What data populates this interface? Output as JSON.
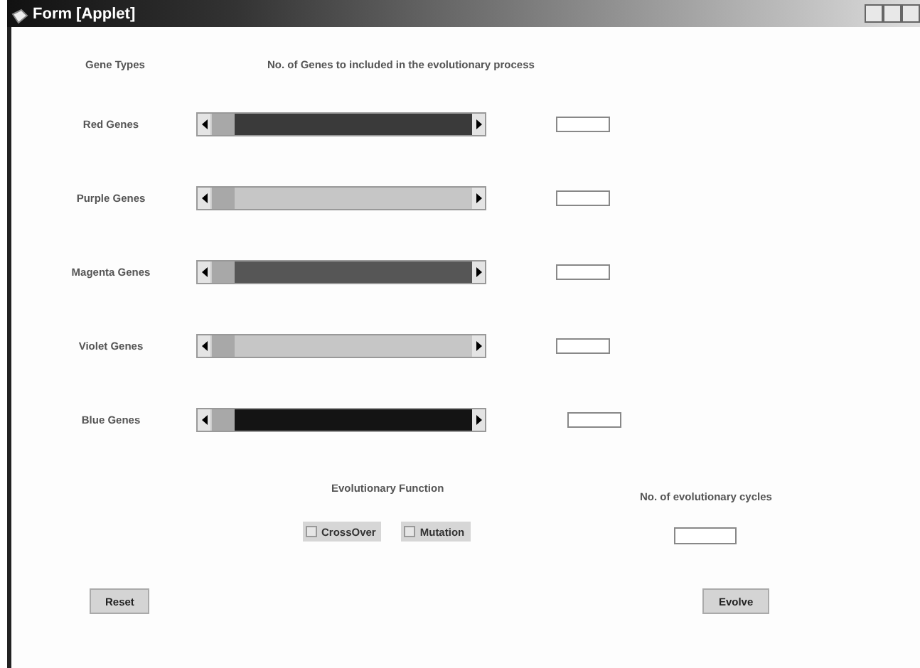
{
  "window": {
    "title": "Form [Applet]"
  },
  "headers": {
    "gene_types": "Gene Types",
    "genes_count": "No. of Genes to included in the evolutionary process"
  },
  "genes": [
    {
      "label": "Red Genes",
      "level": 0,
      "color": "#3a3a3a"
    },
    {
      "label": "Purple Genes",
      "level": 0,
      "color": "#c6c6c6"
    },
    {
      "label": "Magenta Genes",
      "level": 0,
      "color": "#565656"
    },
    {
      "label": "Violet Genes",
      "level": 0,
      "color": "#c6c6c6"
    },
    {
      "label": "Blue Genes",
      "level": 0,
      "color": "#141414"
    }
  ],
  "evolutionary_function": {
    "label": "Evolutionary Function",
    "options": [
      {
        "label": "CrossOver",
        "checked": false
      },
      {
        "label": "Mutation",
        "checked": false
      }
    ]
  },
  "cycles": {
    "label": "No. of evolutionary cycles"
  },
  "buttons": [
    {
      "label": "Reset",
      "kind": "reset"
    },
    {
      "label": "Evolve",
      "kind": "evolve"
    }
  ]
}
